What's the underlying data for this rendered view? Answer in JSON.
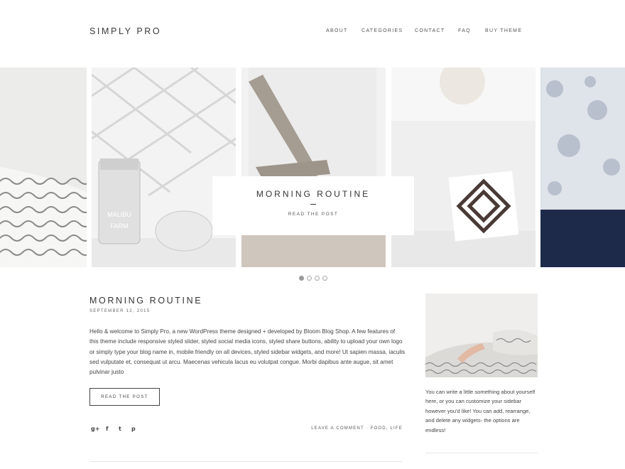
{
  "header": {
    "site_title": "SIMPLY PRO",
    "nav": [
      "ABOUT",
      "CATEGORIES",
      "CONTACT",
      "FAQ",
      "BUY THEME"
    ]
  },
  "slider": {
    "caption_title": "MORNING ROUTINE",
    "caption_link": "READ THE POST",
    "slide_count": 4,
    "active_slide": 1
  },
  "post": {
    "title": "MORNING ROUTINE",
    "date": "SEPTEMBER 12, 2015",
    "body": "Hello & welcome to Simply Pro, a new WordPress theme designed + developed by Bloom Blog Shop. A few features of this theme include responsive styled slider, styled social media icons, styled share buttons, ability to upload your own logo or simply type your blog name in, mobile friendly on all devices, styled sidebar widgets, and more! Ut sapien massa, iaculis sed vulputate et, consequat ut arcu. Maecenas vehicula lacus eu volutpat congue. Morbi dapibus ante augue, sit amet pulvinar justo",
    "read_button": "READ THE POST",
    "share_icons": [
      "google-plus-icon",
      "facebook-icon",
      "twitter-icon",
      "pinterest-icon"
    ],
    "share_glyphs": [
      "g+",
      "f",
      "t",
      "p"
    ],
    "comment_link": "LEAVE A COMMENT",
    "meta_separator": " · ",
    "categories": [
      "FOOD",
      "LIFE"
    ],
    "category_separator": ", "
  },
  "sidebar": {
    "about_text": "You can write a little something about yourself here, or you can customize your sidebar however you'd like! You can add, rearrange, and delete any widgets- the options are endless!"
  },
  "colors": {
    "text": "#333333",
    "background": "#ffffff",
    "rule": "#e6e6e6"
  }
}
